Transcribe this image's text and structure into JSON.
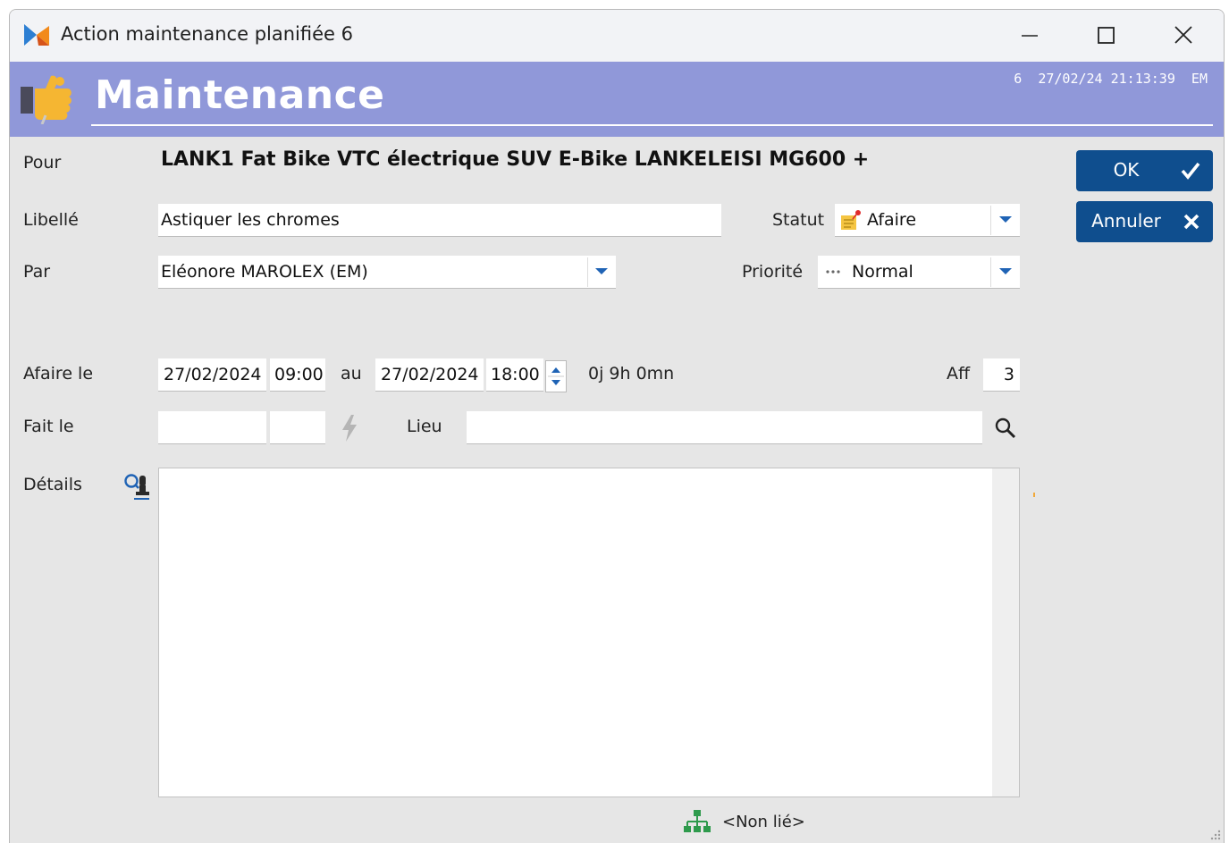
{
  "window": {
    "title": "Action maintenance planifiée 6"
  },
  "header": {
    "title": "Maintenance",
    "info": "6  27/02/24 21:13:39  EM"
  },
  "form": {
    "pour_label": "Pour",
    "pour_value": "LANK1 Fat Bike VTC électrique SUV E-Bike LANKELEISI MG600 +",
    "libelle_label": "Libellé",
    "libelle_value": "Astiquer les chromes",
    "statut_label": "Statut",
    "statut_value": "Afaire",
    "par_label": "Par",
    "par_value": "Eléonore MAROLEX (EM)",
    "priorite_label": "Priorité",
    "priorite_value": "Normal",
    "afaire_label": "Afaire le",
    "start_date": "27/02/2024",
    "start_time": "09:00",
    "au_label": "au",
    "end_date": "27/02/2024",
    "end_time": "18:00",
    "duration": "0j 9h 0mn",
    "aff_label": "Aff",
    "aff_value": "3",
    "fait_label": "Fait le",
    "fait_date": "",
    "fait_time": "",
    "lieu_label": "Lieu",
    "lieu_value": "",
    "details_label": "Détails",
    "details_value": "",
    "link_status": "<Non lié>"
  },
  "buttons": {
    "ok": "OK",
    "cancel": "Annuler"
  },
  "colors": {
    "header": "#9098d9",
    "button": "#0f4e8e",
    "accent_blue": "#1f63b5",
    "window_bg": "#e6e6e6"
  }
}
